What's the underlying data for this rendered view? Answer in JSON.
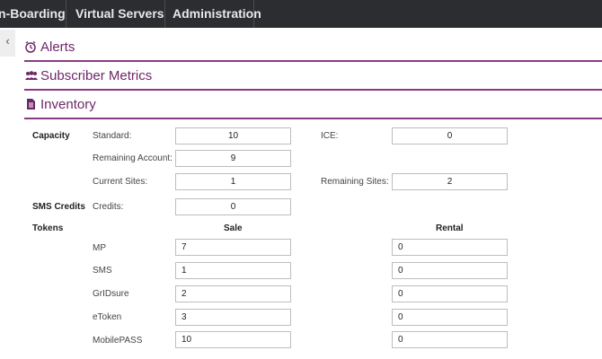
{
  "nav": {
    "items": [
      {
        "label": "n-Boarding"
      },
      {
        "label": "Virtual Servers"
      },
      {
        "label": "Administration"
      }
    ]
  },
  "sidebar_toggle": {
    "glyph": "‹"
  },
  "sections": {
    "alerts": {
      "title": "Alerts",
      "icon": "alarm-clock-icon"
    },
    "metrics": {
      "title": "Subscriber Metrics",
      "icon": "users-icon"
    },
    "inventory": {
      "title": "Inventory",
      "icon": "document-icon"
    }
  },
  "inventory": {
    "capacity": {
      "group_label": "Capacity",
      "standard": {
        "label": "Standard:",
        "value": "10"
      },
      "ice": {
        "label": "ICE:",
        "value": "0"
      },
      "remaining_account": {
        "label": "Remaining Account:",
        "value": "9"
      },
      "current_sites": {
        "label": "Current Sites:",
        "value": "1"
      },
      "remaining_sites": {
        "label": "Remaining Sites:",
        "value": "2"
      }
    },
    "sms_credits": {
      "group_label": "SMS Credits",
      "credits": {
        "label": "Credits:",
        "value": "0"
      }
    },
    "tokens": {
      "group_label": "Tokens",
      "sale_header": "Sale",
      "rental_header": "Rental",
      "rows": [
        {
          "label": "MP",
          "sale": "7",
          "rental": "0"
        },
        {
          "label": "SMS",
          "sale": "1",
          "rental": "0"
        },
        {
          "label": "GrIDsure",
          "sale": "2",
          "rental": "0"
        },
        {
          "label": "eToken",
          "sale": "3",
          "rental": "0"
        },
        {
          "label": "MobilePASS",
          "sale": "10",
          "rental": "0"
        }
      ]
    }
  },
  "colors": {
    "accent": "#8a3a82",
    "nav_bg": "#2b2d30",
    "section_title": "#6d2769"
  }
}
